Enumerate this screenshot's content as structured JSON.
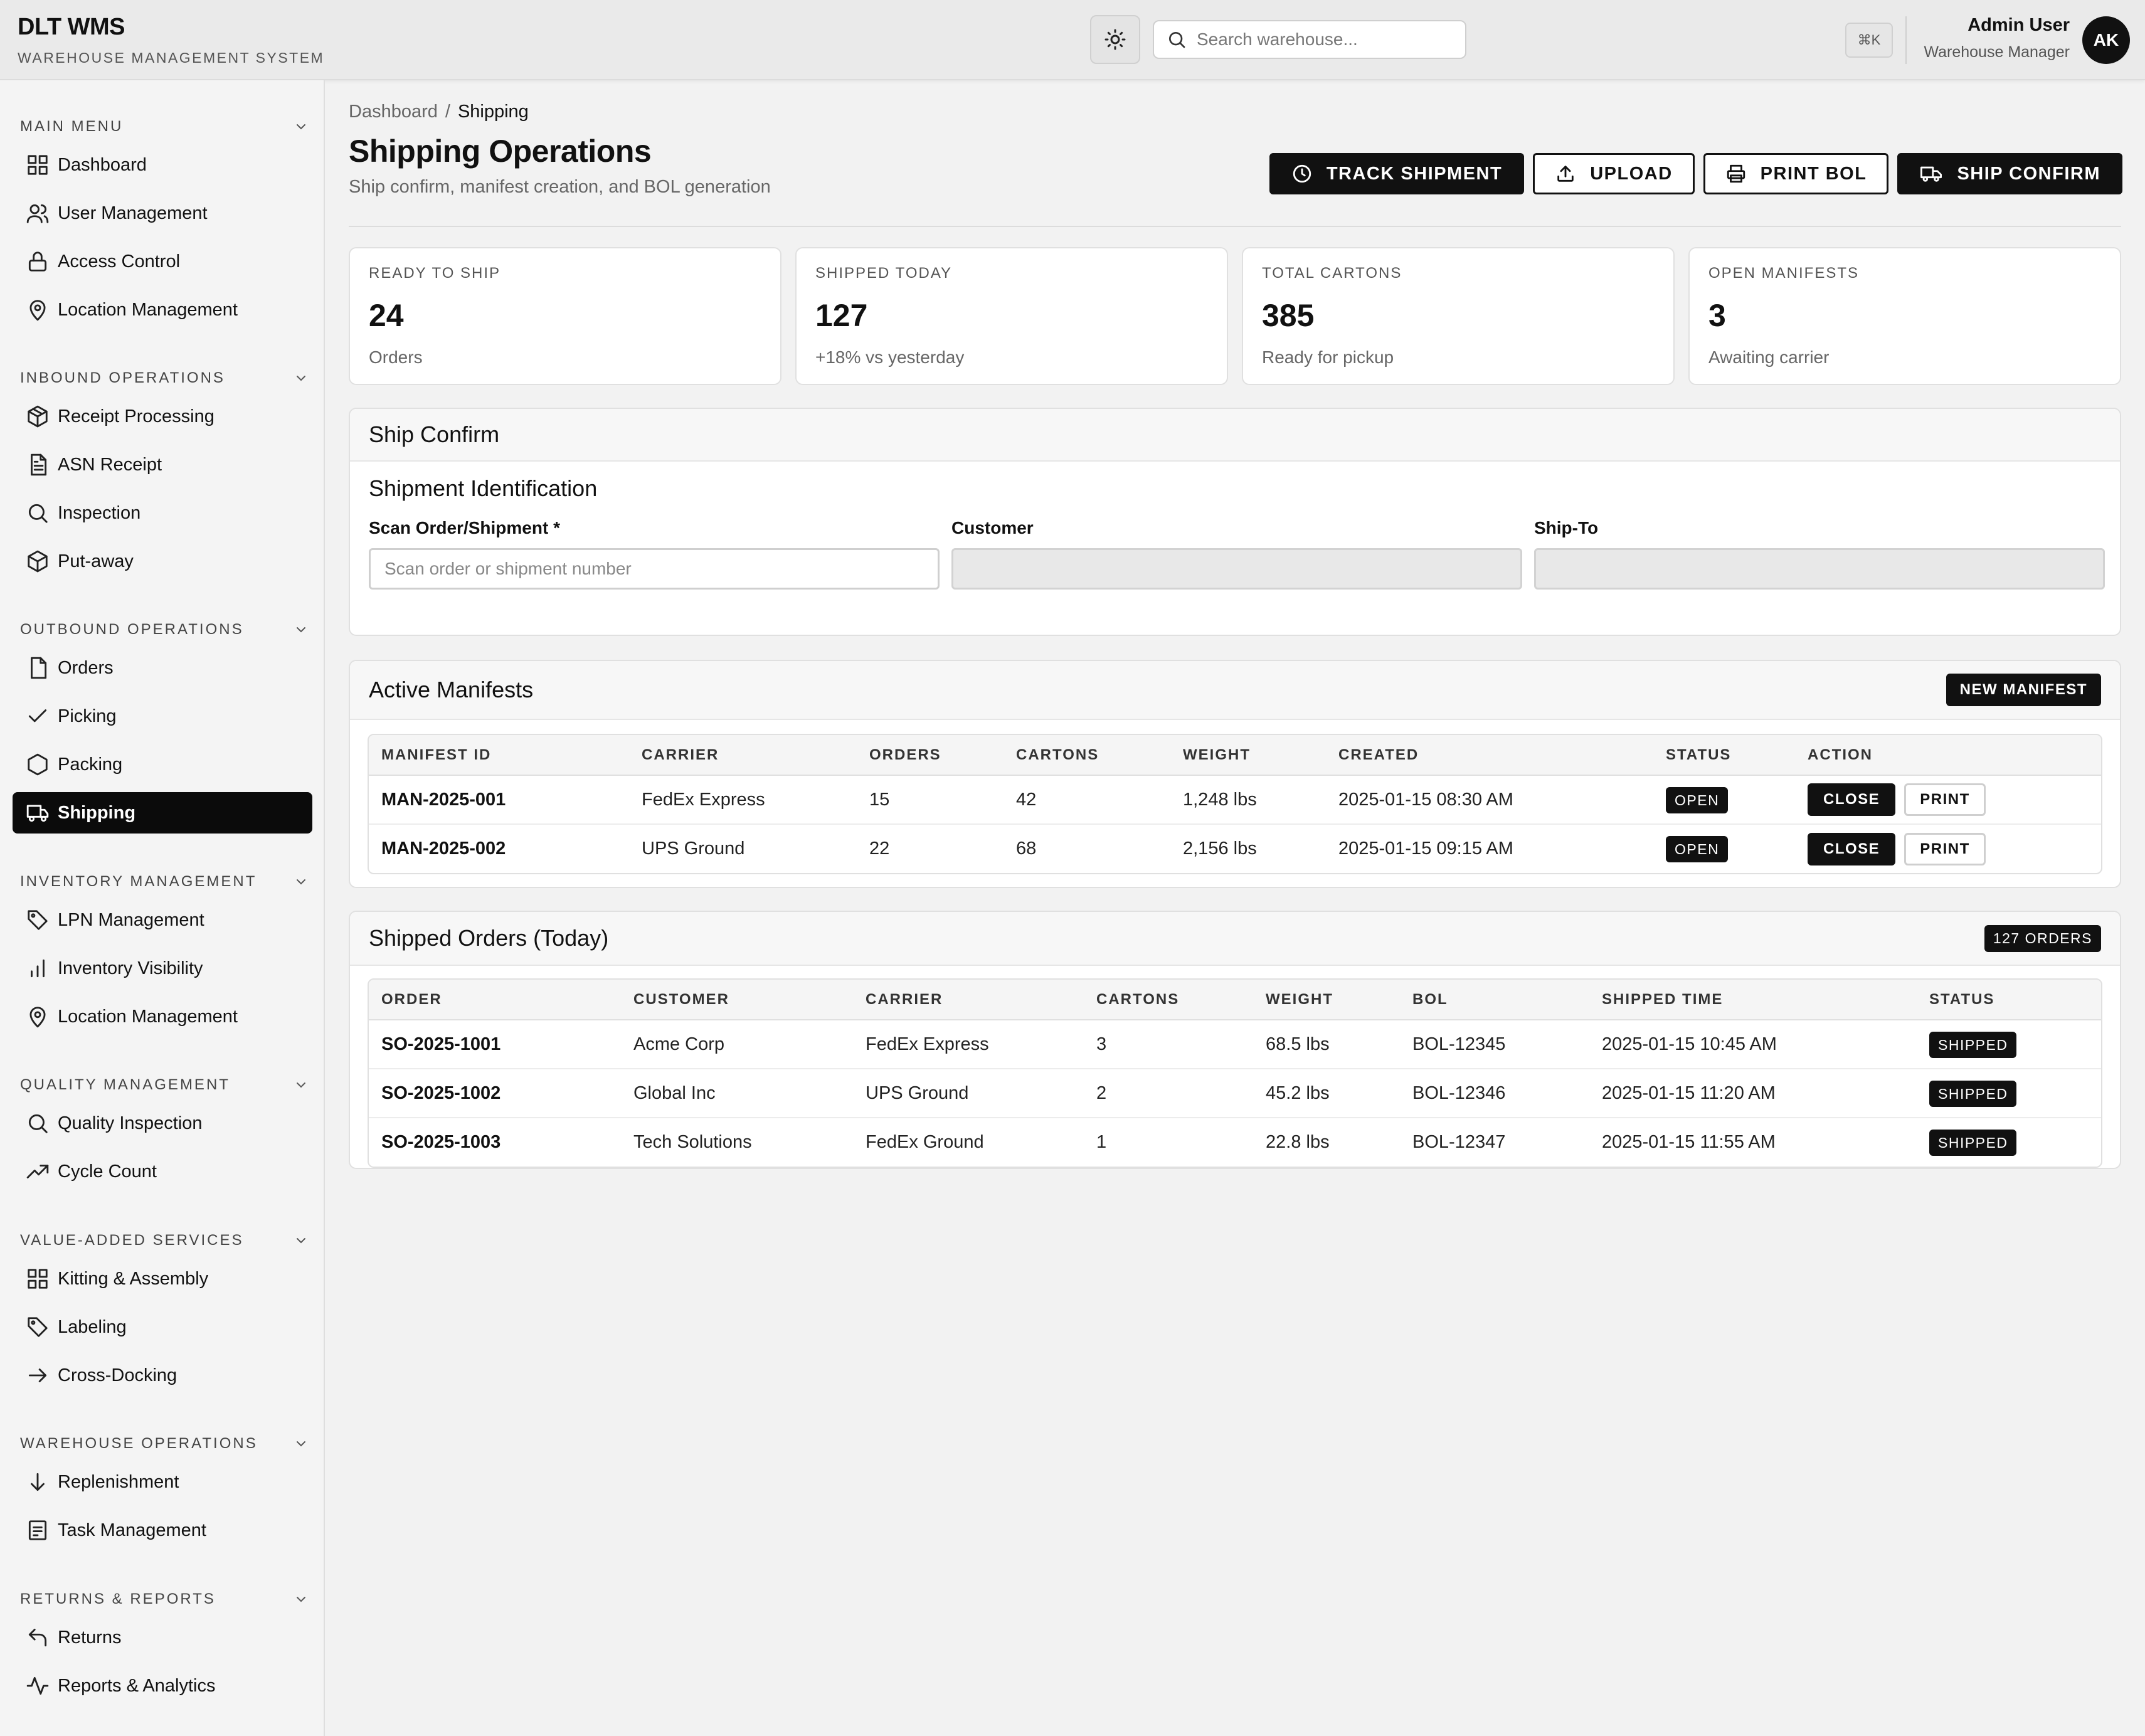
{
  "app": {
    "title": "DLT WMS",
    "subtitle": "WAREHOUSE MANAGEMENT SYSTEM"
  },
  "header": {
    "search_placeholder": "Search warehouse...",
    "shortcut": "⌘K",
    "user_name": "Admin User",
    "user_role": "Warehouse Manager",
    "avatar_initials": "AK"
  },
  "sidebar": {
    "sections": [
      {
        "title": "MAIN MENU",
        "items": [
          {
            "label": "Dashboard",
            "icon": "grid-icon"
          },
          {
            "label": "User Management",
            "icon": "users-icon"
          },
          {
            "label": "Access Control",
            "icon": "lock-icon"
          },
          {
            "label": "Location Management",
            "icon": "map-pin-icon"
          }
        ]
      },
      {
        "title": "INBOUND OPERATIONS",
        "items": [
          {
            "label": "Receipt Processing",
            "icon": "box-icon"
          },
          {
            "label": "ASN Receipt",
            "icon": "file-text-icon"
          },
          {
            "label": "Inspection",
            "icon": "search-icon"
          },
          {
            "label": "Put-away",
            "icon": "package-icon"
          }
        ]
      },
      {
        "title": "OUTBOUND OPERATIONS",
        "items": [
          {
            "label": "Orders",
            "icon": "file-icon"
          },
          {
            "label": "Picking",
            "icon": "check-icon"
          },
          {
            "label": "Packing",
            "icon": "hexagon-icon"
          },
          {
            "label": "Shipping",
            "icon": "truck-icon",
            "active": true
          }
        ]
      },
      {
        "title": "INVENTORY MANAGEMENT",
        "items": [
          {
            "label": "LPN Management",
            "icon": "tag-icon"
          },
          {
            "label": "Inventory Visibility",
            "icon": "bar-chart-icon"
          },
          {
            "label": "Location Management",
            "icon": "map-pin-icon"
          }
        ]
      },
      {
        "title": "QUALITY MANAGEMENT",
        "items": [
          {
            "label": "Quality Inspection",
            "icon": "search-icon"
          },
          {
            "label": "Cycle Count",
            "icon": "trending-up-icon"
          }
        ]
      },
      {
        "title": "VALUE-ADDED SERVICES",
        "items": [
          {
            "label": "Kitting & Assembly",
            "icon": "grid-icon"
          },
          {
            "label": "Labeling",
            "icon": "tag-icon"
          },
          {
            "label": "Cross-Docking",
            "icon": "arrow-right-icon"
          }
        ]
      },
      {
        "title": "WAREHOUSE OPERATIONS",
        "items": [
          {
            "label": "Replenishment",
            "icon": "arrow-down-icon"
          },
          {
            "label": "Task Management",
            "icon": "task-list-icon"
          }
        ]
      },
      {
        "title": "RETURNS & REPORTS",
        "items": [
          {
            "label": "Returns",
            "icon": "corner-up-left-icon"
          },
          {
            "label": "Reports & Analytics",
            "icon": "activity-icon"
          }
        ]
      }
    ]
  },
  "breadcrumb": {
    "root": "Dashboard",
    "separator": "/",
    "current": "Shipping"
  },
  "page": {
    "title": "Shipping Operations",
    "subtitle": "Ship confirm, manifest creation, and BOL generation"
  },
  "actions": {
    "track": "TRACK SHIPMENT",
    "upload": "UPLOAD",
    "print_bol": "PRINT BOL",
    "ship_confirm": "SHIP CONFIRM"
  },
  "stats": [
    {
      "label": "READY TO SHIP",
      "value": "24",
      "note": "Orders"
    },
    {
      "label": "SHIPPED TODAY",
      "value": "127",
      "note": "+18% vs yesterday"
    },
    {
      "label": "TOTAL CARTONS",
      "value": "385",
      "note": "Ready for pickup"
    },
    {
      "label": "OPEN MANIFESTS",
      "value": "3",
      "note": "Awaiting carrier"
    }
  ],
  "ship_confirm": {
    "title": "Ship Confirm",
    "section_title": "Shipment Identification",
    "scan_label": "Scan Order/Shipment *",
    "scan_placeholder": "Scan order or shipment number",
    "customer_label": "Customer",
    "shipto_label": "Ship-To"
  },
  "manifests": {
    "title": "Active Manifests",
    "new_button": "NEW MANIFEST",
    "columns": [
      "MANIFEST ID",
      "CARRIER",
      "ORDERS",
      "CARTONS",
      "WEIGHT",
      "CREATED",
      "STATUS",
      "ACTION"
    ],
    "rows": [
      {
        "id": "MAN-2025-001",
        "carrier": "FedEx Express",
        "orders": "15",
        "cartons": "42",
        "weight": "1,248 lbs",
        "created": "2025-01-15 08:30 AM",
        "status": "OPEN",
        "close": "CLOSE",
        "print": "PRINT"
      },
      {
        "id": "MAN-2025-002",
        "carrier": "UPS Ground",
        "orders": "22",
        "cartons": "68",
        "weight": "2,156 lbs",
        "created": "2025-01-15 09:15 AM",
        "status": "OPEN",
        "close": "CLOSE",
        "print": "PRINT"
      }
    ]
  },
  "shipped": {
    "title": "Shipped Orders (Today)",
    "count_badge": "127 ORDERS",
    "columns": [
      "ORDER",
      "CUSTOMER",
      "CARRIER",
      "CARTONS",
      "WEIGHT",
      "BOL",
      "SHIPPED TIME",
      "STATUS"
    ],
    "rows": [
      {
        "order": "SO-2025-1001",
        "customer": "Acme Corp",
        "carrier": "FedEx Express",
        "cartons": "3",
        "weight": "68.5 lbs",
        "bol": "BOL-12345",
        "time": "2025-01-15 10:45 AM",
        "status": "SHIPPED"
      },
      {
        "order": "SO-2025-1002",
        "customer": "Global Inc",
        "carrier": "UPS Ground",
        "cartons": "2",
        "weight": "45.2 lbs",
        "bol": "BOL-12346",
        "time": "2025-01-15 11:20 AM",
        "status": "SHIPPED"
      },
      {
        "order": "SO-2025-1003",
        "customer": "Tech Solutions",
        "carrier": "FedEx Ground",
        "cartons": "1",
        "weight": "22.8 lbs",
        "bol": "BOL-12347",
        "time": "2025-01-15 11:55 AM",
        "status": "SHIPPED"
      }
    ]
  },
  "colors": {
    "accent": "#111111",
    "background": "#f2f2f2",
    "card": "#ffffff"
  }
}
